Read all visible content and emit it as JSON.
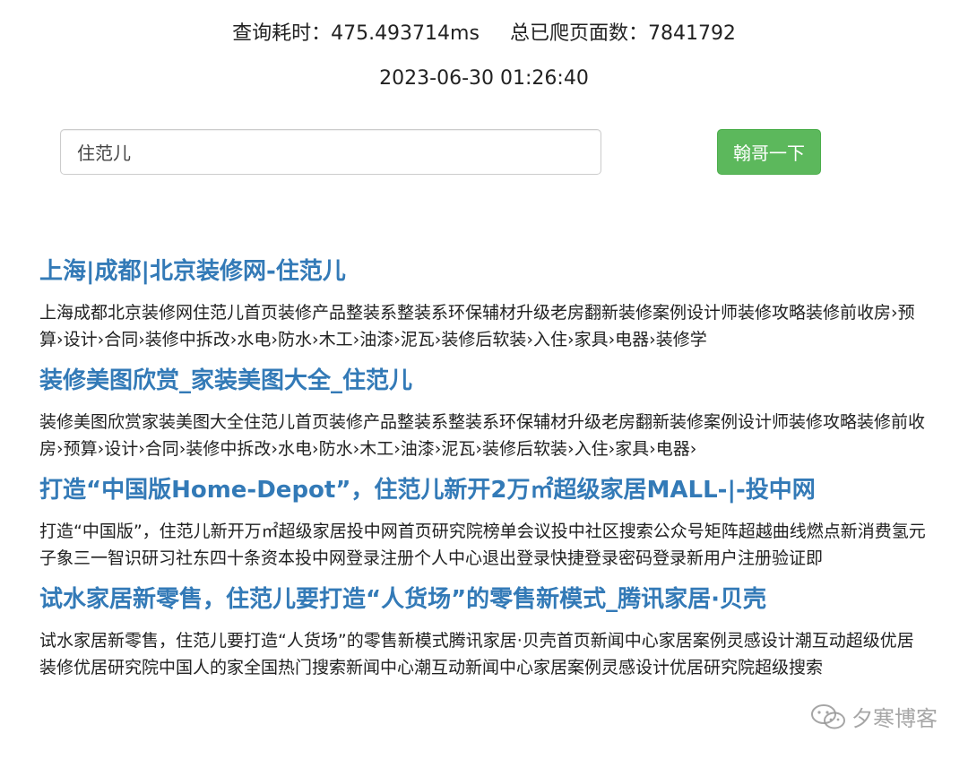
{
  "header": {
    "query_time_label": "查询耗时：",
    "query_time_value": "475.493714ms",
    "pages_label": "总已爬页面数：",
    "pages_value": "7841792",
    "datetime": "2023-06-30 01:26:40"
  },
  "search": {
    "value": "住范儿",
    "button_label": "翰哥一下"
  },
  "results": [
    {
      "title": "上海|成都|北京装修网-住范儿",
      "snippet": "上海成都北京装修网住范儿首页装修产品整装系整装系环保辅材升级老房翻新装修案例设计师装修攻略装修前收房›预算›设计›合同›装修中拆改›水电›防水›木工›油漆›泥瓦›装修后软装›入住›家具›电器›装修学"
    },
    {
      "title": "装修美图欣赏_家装美图大全_住范儿",
      "snippet": "装修美图欣赏家装美图大全住范儿首页装修产品整装系整装系环保辅材升级老房翻新装修案例设计师装修攻略装修前收房›预算›设计›合同›装修中拆改›水电›防水›木工›油漆›泥瓦›装修后软装›入住›家具›电器›"
    },
    {
      "title": "打造“中国版Home-Depot”，住范儿新开2万㎡超级家居MALL-|-投中网",
      "snippet": "打造“中国版”，住范儿新开万㎡超级家居投中网首页研究院榜单会议投中社区搜索公众号矩阵超越曲线燃点新消费氢元子象三一智识研习社东四十条资本投中网登录注册个人中心退出登录快捷登录密码登录新用户注册验证即"
    },
    {
      "title": "试水家居新零售，住范儿要打造“人货场”的零售新模式_腾讯家居·贝壳",
      "snippet": "试水家居新零售，住范儿要打造“人货场”的零售新模式腾讯家居·贝壳首页新闻中心家居案例灵感设计潮互动超级优居装修优居研究院中国人的家全国热门搜索新闻中心潮互动新闻中心家居案例灵感设计优居研究院超级搜索"
    }
  ],
  "watermark": {
    "text": "夕寒博客",
    "icon": "wechat-icon"
  }
}
